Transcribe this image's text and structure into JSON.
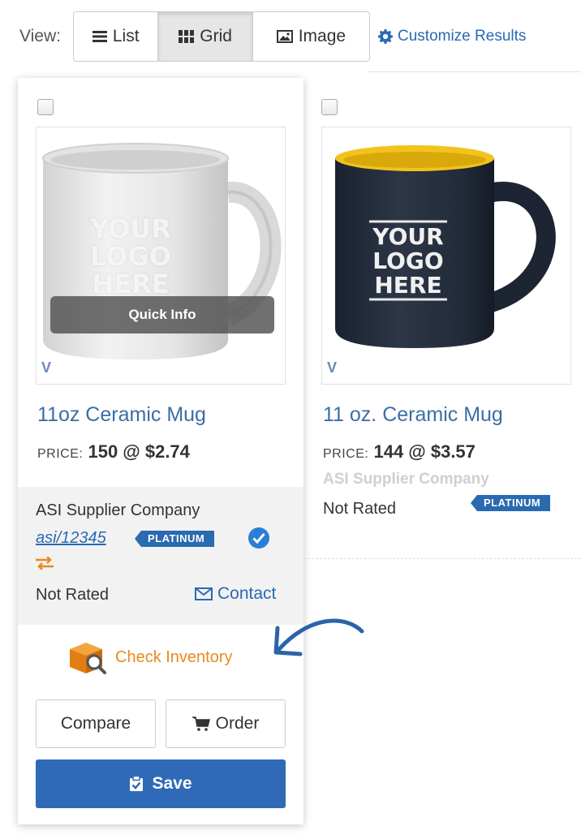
{
  "view_bar": {
    "label": "View:",
    "options": [
      {
        "label": "List",
        "icon": "list-icon",
        "active": false
      },
      {
        "label": "Grid",
        "icon": "grid-icon",
        "active": true
      },
      {
        "label": "Image",
        "icon": "image-icon",
        "active": false
      }
    ],
    "customize_label": "Customize Results"
  },
  "products": [
    {
      "title": "11oz Ceramic Mug",
      "price_label": "PRICE:",
      "price_value": "150 @ $2.74",
      "logo_lines": [
        "YOUR",
        "LOGO",
        "HERE"
      ],
      "quick_info_label": "Quick Info",
      "supplier": {
        "name": "ASI Supplier Company",
        "asi_number": "asi/12345",
        "tier": "PLATINUM",
        "rating": "Not Rated",
        "contact_label": "Contact"
      },
      "check_inventory_label": "Check Inventory",
      "compare_label": "Compare",
      "order_label": "Order",
      "save_label": "Save"
    },
    {
      "title": "11 oz. Ceramic Mug",
      "price_label": "PRICE:",
      "price_value": "144 @ $3.57",
      "logo_lines": [
        "YOUR",
        "LOGO",
        "HERE"
      ],
      "supplier": {
        "name": "ASI Supplier Company",
        "tier": "PLATINUM",
        "rating": "Not Rated"
      }
    }
  ],
  "colors": {
    "link_blue": "#2a6ab1",
    "save_blue": "#2e6ab7",
    "inventory_orange": "#e98a1f",
    "mug_yellow": "#f5c518",
    "mug_dark": "#1f2835"
  }
}
